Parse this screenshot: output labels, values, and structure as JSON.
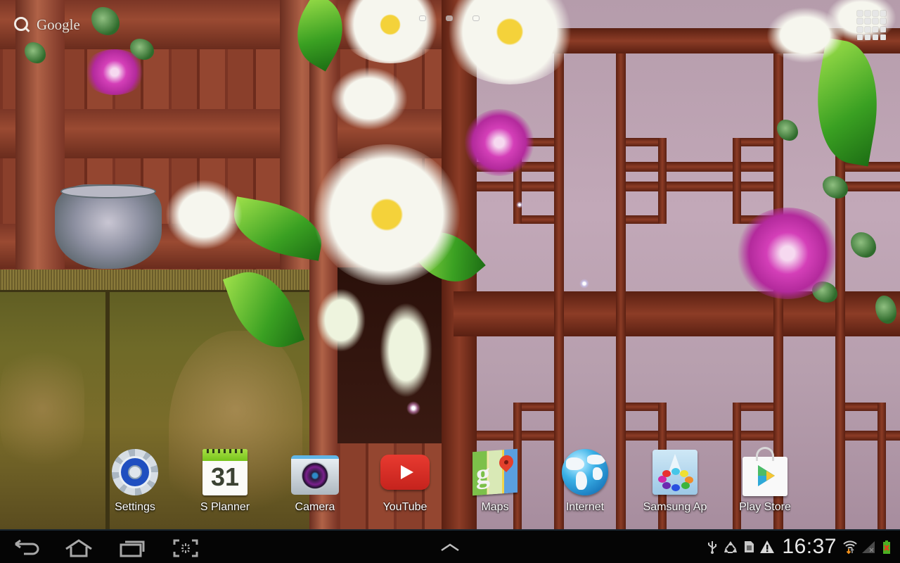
{
  "home": {
    "search_widget": {
      "label": "Google",
      "icon": "search-icon"
    },
    "page_indicator": {
      "pages": 3,
      "current": 2
    },
    "apps_button": {
      "icon": "apps-grid-icon"
    },
    "shortcuts": [
      {
        "label": "Settings",
        "icon": "settings-gear-icon"
      },
      {
        "label": "S Planner",
        "icon": "calendar-icon",
        "calendar_day": "31"
      },
      {
        "label": "Camera",
        "icon": "camera-icon"
      },
      {
        "label": "YouTube",
        "icon": "youtube-icon"
      },
      {
        "label": "Maps",
        "icon": "maps-icon",
        "glyph": "g"
      },
      {
        "label": "Internet",
        "icon": "globe-icon"
      },
      {
        "label": "Samsung Ap",
        "icon": "samsung-apps-icon"
      },
      {
        "label": "Play Store",
        "icon": "play-store-icon"
      }
    ]
  },
  "system_bar": {
    "nav": [
      {
        "name": "back",
        "icon": "back-arrow-icon"
      },
      {
        "name": "home",
        "icon": "home-icon"
      },
      {
        "name": "recent-apps",
        "icon": "recent-apps-icon"
      },
      {
        "name": "screenshot",
        "icon": "screenshot-capture-icon"
      }
    ],
    "center_button": {
      "icon": "chevron-up-icon"
    },
    "status_icons": [
      {
        "name": "usb",
        "icon": "usb-icon"
      },
      {
        "name": "sync",
        "icon": "recycle-sync-icon"
      },
      {
        "name": "sd-card",
        "icon": "sd-card-icon"
      },
      {
        "name": "warning",
        "icon": "warning-icon"
      }
    ],
    "clock": "16:37",
    "wifi": {
      "icon": "wifi-icon",
      "activity": "downloading"
    },
    "signal": {
      "icon": "no-signal-icon"
    },
    "battery": {
      "icon": "battery-charging-error-icon",
      "color": "#4caf22",
      "alert_color": "#e53b1e"
    }
  },
  "colors": {
    "system_bar_bg": "#050505",
    "label_text": "#ffffff",
    "nav_icon": "#a8a8a8"
  }
}
